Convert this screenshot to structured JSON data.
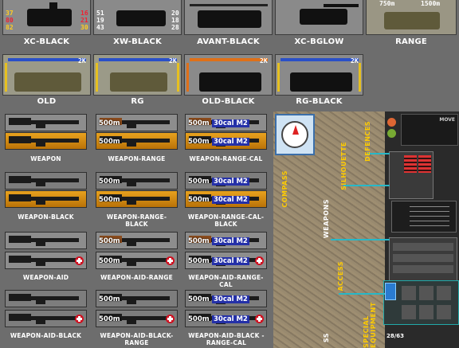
{
  "top_row": {
    "labels": [
      "XC-BLACK",
      "XW-BLACK",
      "AVANT-BLACK",
      "XC-BGLOW",
      "RANGE"
    ],
    "xc_stats": {
      "left": [
        "37",
        "80",
        "82"
      ],
      "right": [
        "16",
        "21",
        "30"
      ]
    },
    "xw_stats": {
      "left": [
        "51",
        "19",
        "43"
      ],
      "right": [
        "20",
        "18",
        "28"
      ]
    },
    "range_values": [
      "750m",
      "1500m"
    ]
  },
  "second_row": {
    "labels": [
      "OLD",
      "RG",
      "OLD-BLACK",
      "RG-BLACK"
    ],
    "badge": "2K"
  },
  "weapons": {
    "range_value": "500m",
    "cal_value": "30cal M2",
    "captions": [
      "WEAPON",
      "WEAPON-RANGE",
      "WEAPON-RANGE-CAL",
      "WEAPON-BLACK",
      "WEAPON-RANGE-BLACK",
      "WEAPON-RANGE-CAL-BLACK",
      "WEAPON-AID",
      "WEAPON-AID-RANGE",
      "WEAPON-AID-RANGE-CAL",
      "WEAPON-AID-BLACK",
      "WEAPON-AID-BLACK-RANGE",
      "WEAPON-AID-BLACK -RANGE-CAL"
    ]
  },
  "right_panel": {
    "labels": {
      "compass": "COMPASS",
      "weapons": "WEAPONS",
      "silhouette": "SILHOUETTE",
      "defences": "DEFENCES",
      "access": "ACCESS",
      "special_equipment": "SPECIAL EQUIPMENT",
      "ss": "SS"
    },
    "move_label": "MOVE",
    "ammo_counter": "28/63"
  },
  "colors": {
    "label_yellow": "#fc0",
    "connector_cyan": "#27b8c8",
    "aid_red": "#d01020"
  }
}
